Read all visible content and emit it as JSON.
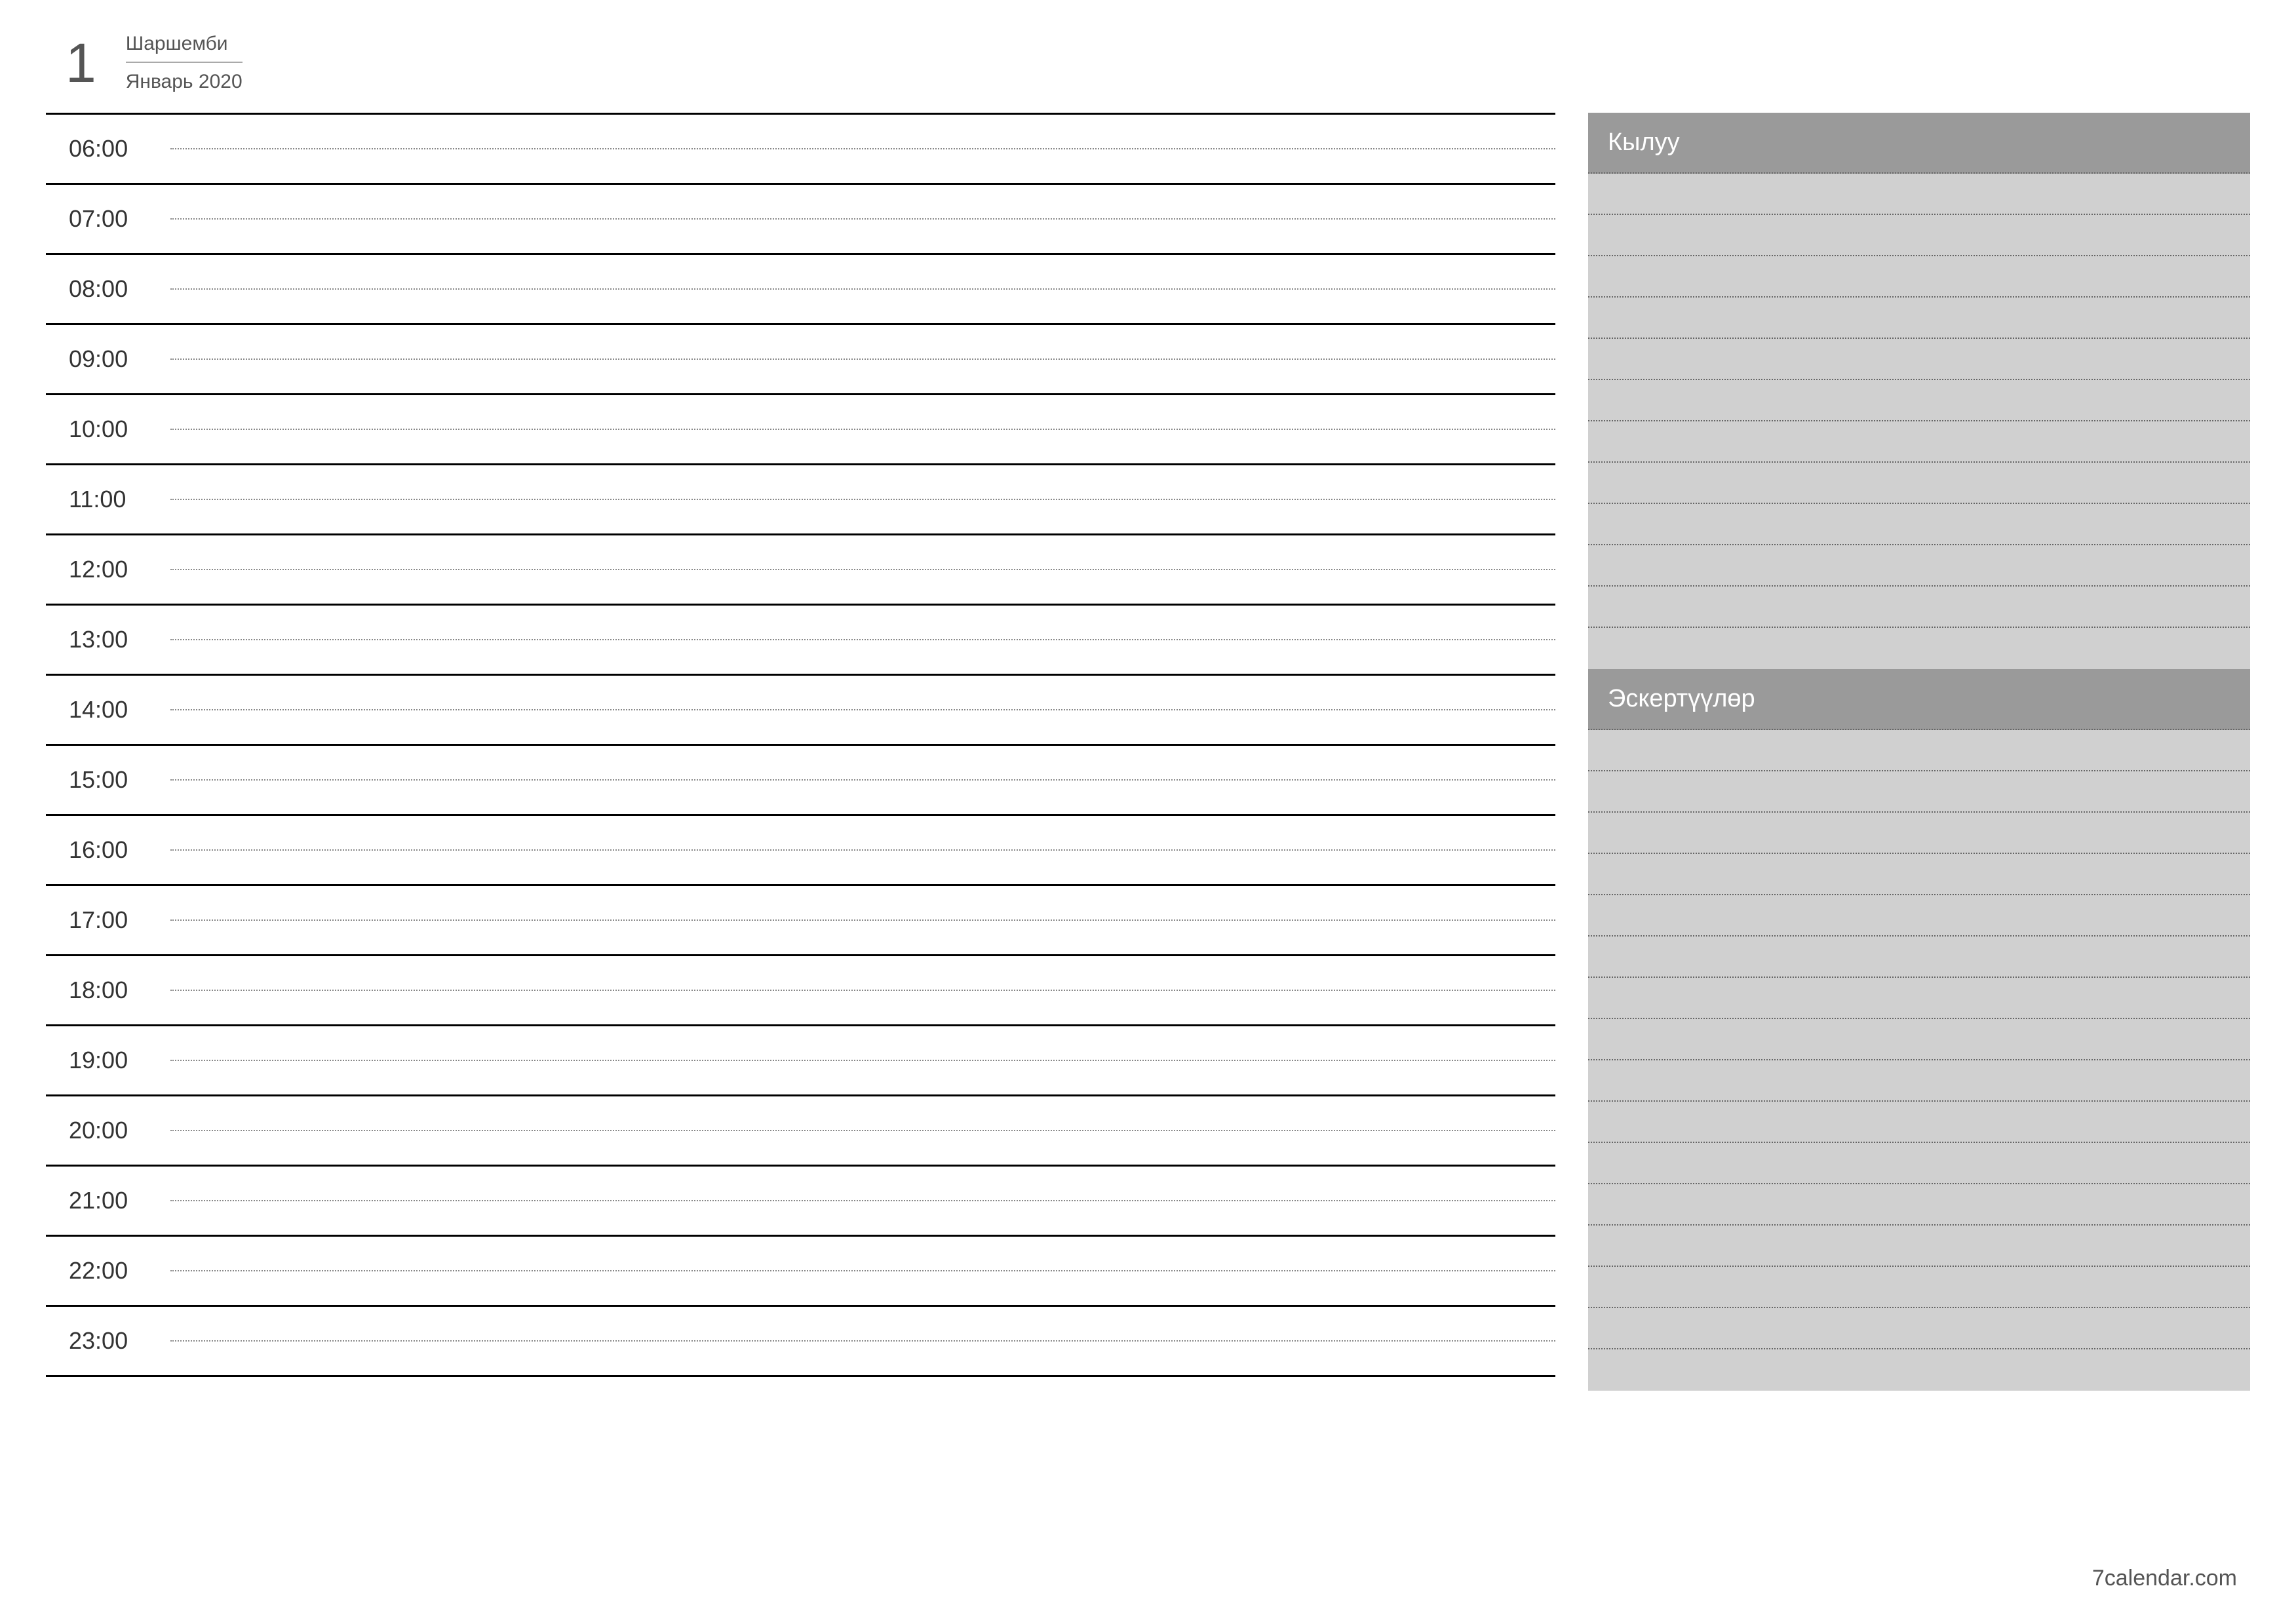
{
  "header": {
    "day_number": "1",
    "weekday": "Шаршемби",
    "month_year": "Январь 2020"
  },
  "schedule": {
    "times": [
      "06:00",
      "07:00",
      "08:00",
      "09:00",
      "10:00",
      "11:00",
      "12:00",
      "13:00",
      "14:00",
      "15:00",
      "16:00",
      "17:00",
      "18:00",
      "19:00",
      "20:00",
      "21:00",
      "22:00",
      "23:00"
    ]
  },
  "sidebar": {
    "todo_label": "Кылуу",
    "notes_label": "Эскертүүлөр",
    "todo_lines": 12,
    "notes_lines": 16
  },
  "footer": {
    "site": "7calendar.com"
  }
}
